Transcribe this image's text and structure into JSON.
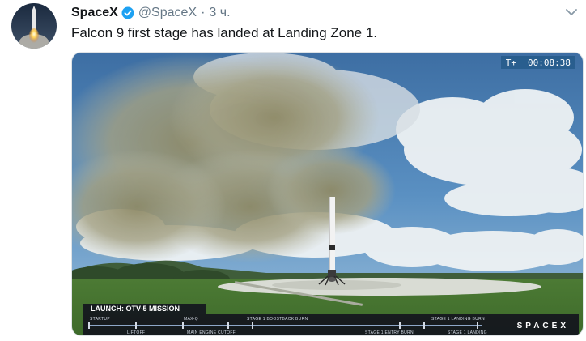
{
  "tweet": {
    "author_name": "SpaceX",
    "author_handle": "@SpaceX",
    "separator": "·",
    "time": "3 ч.",
    "text": "Falcon 9 first stage has landed at Landing Zone 1.",
    "verified_icon": "verified-badge-icon",
    "menu_icon": "chevron-down-icon"
  },
  "media": {
    "timer_prefix": "T+",
    "timer_value": "00:08:38",
    "mission_label": "LAUNCH: OTV-5 MISSION",
    "milestones_top": [
      "STARTUP",
      "MAX-Q",
      "STAGE 1 BOOSTBACK BURN",
      "STAGE 1 LANDING BURN"
    ],
    "milestones_bottom": [
      "LIFTOFF",
      "MAIN ENGINE CUTOFF",
      "STAGE 1 ENTRY BURN",
      "STAGE 1 LANDING"
    ],
    "logo": "SPACEX"
  },
  "colors": {
    "sky": "#4f86b8",
    "verified": "#1da1f2",
    "text": "#14171a",
    "muted": "#657786"
  }
}
